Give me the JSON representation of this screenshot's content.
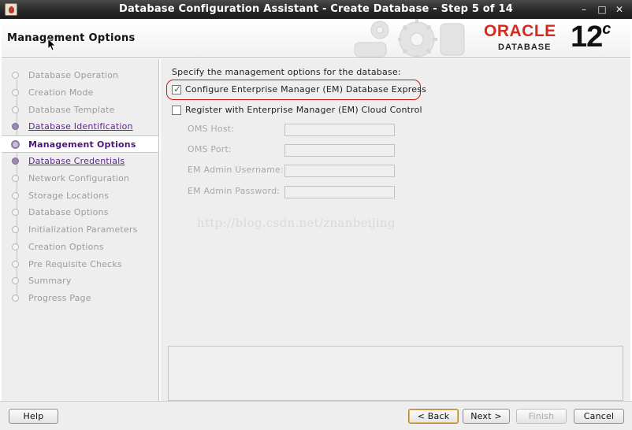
{
  "window": {
    "title": "Database Configuration Assistant - Create Database - Step 5 of 14",
    "controls": [
      "–",
      "□",
      "✕"
    ]
  },
  "header": {
    "page_title": "Management Options",
    "brand": {
      "oracle": "ORACLE",
      "database": "DATABASE",
      "version": "12",
      "version_suffix": "c"
    }
  },
  "sidebar": {
    "steps": [
      {
        "label": "Database Operation",
        "state": "pending"
      },
      {
        "label": "Creation Mode",
        "state": "pending"
      },
      {
        "label": "Database Template",
        "state": "pending"
      },
      {
        "label": "Database Identification",
        "state": "done"
      },
      {
        "label": "Management Options",
        "state": "current"
      },
      {
        "label": "Database Credentials",
        "state": "done"
      },
      {
        "label": "Network Configuration",
        "state": "pending"
      },
      {
        "label": "Storage Locations",
        "state": "pending"
      },
      {
        "label": "Database Options",
        "state": "pending"
      },
      {
        "label": "Initialization Parameters",
        "state": "pending"
      },
      {
        "label": "Creation Options",
        "state": "pending"
      },
      {
        "label": "Pre Requisite Checks",
        "state": "pending"
      },
      {
        "label": "Summary",
        "state": "pending"
      },
      {
        "label": "Progress Page",
        "state": "pending"
      }
    ]
  },
  "main": {
    "intro": "Specify the management options for the database:",
    "em_express": {
      "label": "Configure Enterprise Manager (EM) Database Express",
      "checked": true
    },
    "cloud_control": {
      "label": "Register with Enterprise Manager (EM) Cloud Control",
      "checked": false
    },
    "fields": {
      "oms_host": {
        "label": "OMS Host:",
        "value": ""
      },
      "oms_port": {
        "label": "OMS Port:",
        "value": ""
      },
      "em_admin_username": {
        "label": "EM Admin Username:",
        "value": ""
      },
      "em_admin_password": {
        "label": "EM Admin Password:",
        "value": ""
      }
    },
    "watermark": "http://blog.csdn.net/znanbeijing"
  },
  "buttons": {
    "help": "Help",
    "back": "< Back",
    "next": "Next >",
    "finish": "Finish",
    "cancel": "Cancel"
  },
  "colors": {
    "accent_purple": "#4b1877",
    "oracle_red": "#d62a1e",
    "highlight_red": "#d01818"
  }
}
